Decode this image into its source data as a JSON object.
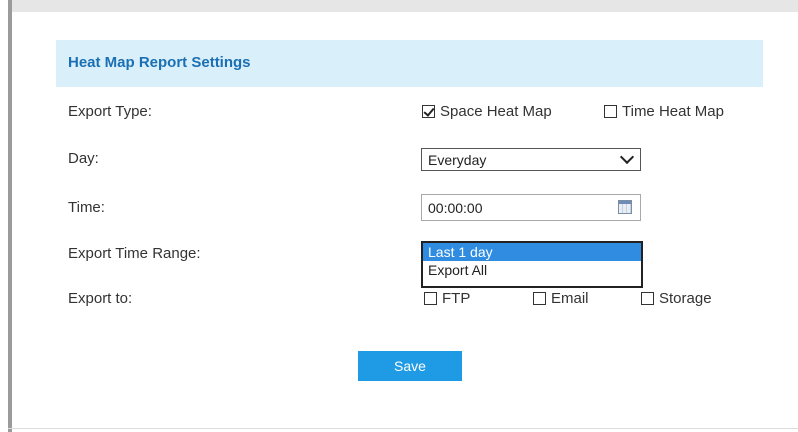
{
  "panel": {
    "title": "Heat Map Report Settings"
  },
  "export_type": {
    "label": "Export Type:",
    "options": [
      {
        "label": "Space Heat Map",
        "checked": true
      },
      {
        "label": "Time Heat Map",
        "checked": false
      }
    ]
  },
  "day": {
    "label": "Day:",
    "selected": "Everyday",
    "icon": "chevron-down-icon"
  },
  "time": {
    "label": "Time:",
    "value": "00:00:00",
    "icon": "calendar-icon"
  },
  "export_time_range": {
    "label": "Export Time Range:",
    "options": [
      "Last 1 day",
      "Export All"
    ],
    "selected_index": 0
  },
  "export_to": {
    "label": "Export to:",
    "options": [
      {
        "label": "FTP",
        "checked": false
      },
      {
        "label": "Email",
        "checked": false
      },
      {
        "label": "Storage",
        "checked": false
      }
    ]
  },
  "actions": {
    "save_label": "Save"
  },
  "colors": {
    "header_bg": "#d9f0fb",
    "title": "#1b6fb3",
    "button": "#1f9be6",
    "selection": "#2f8ce0"
  }
}
